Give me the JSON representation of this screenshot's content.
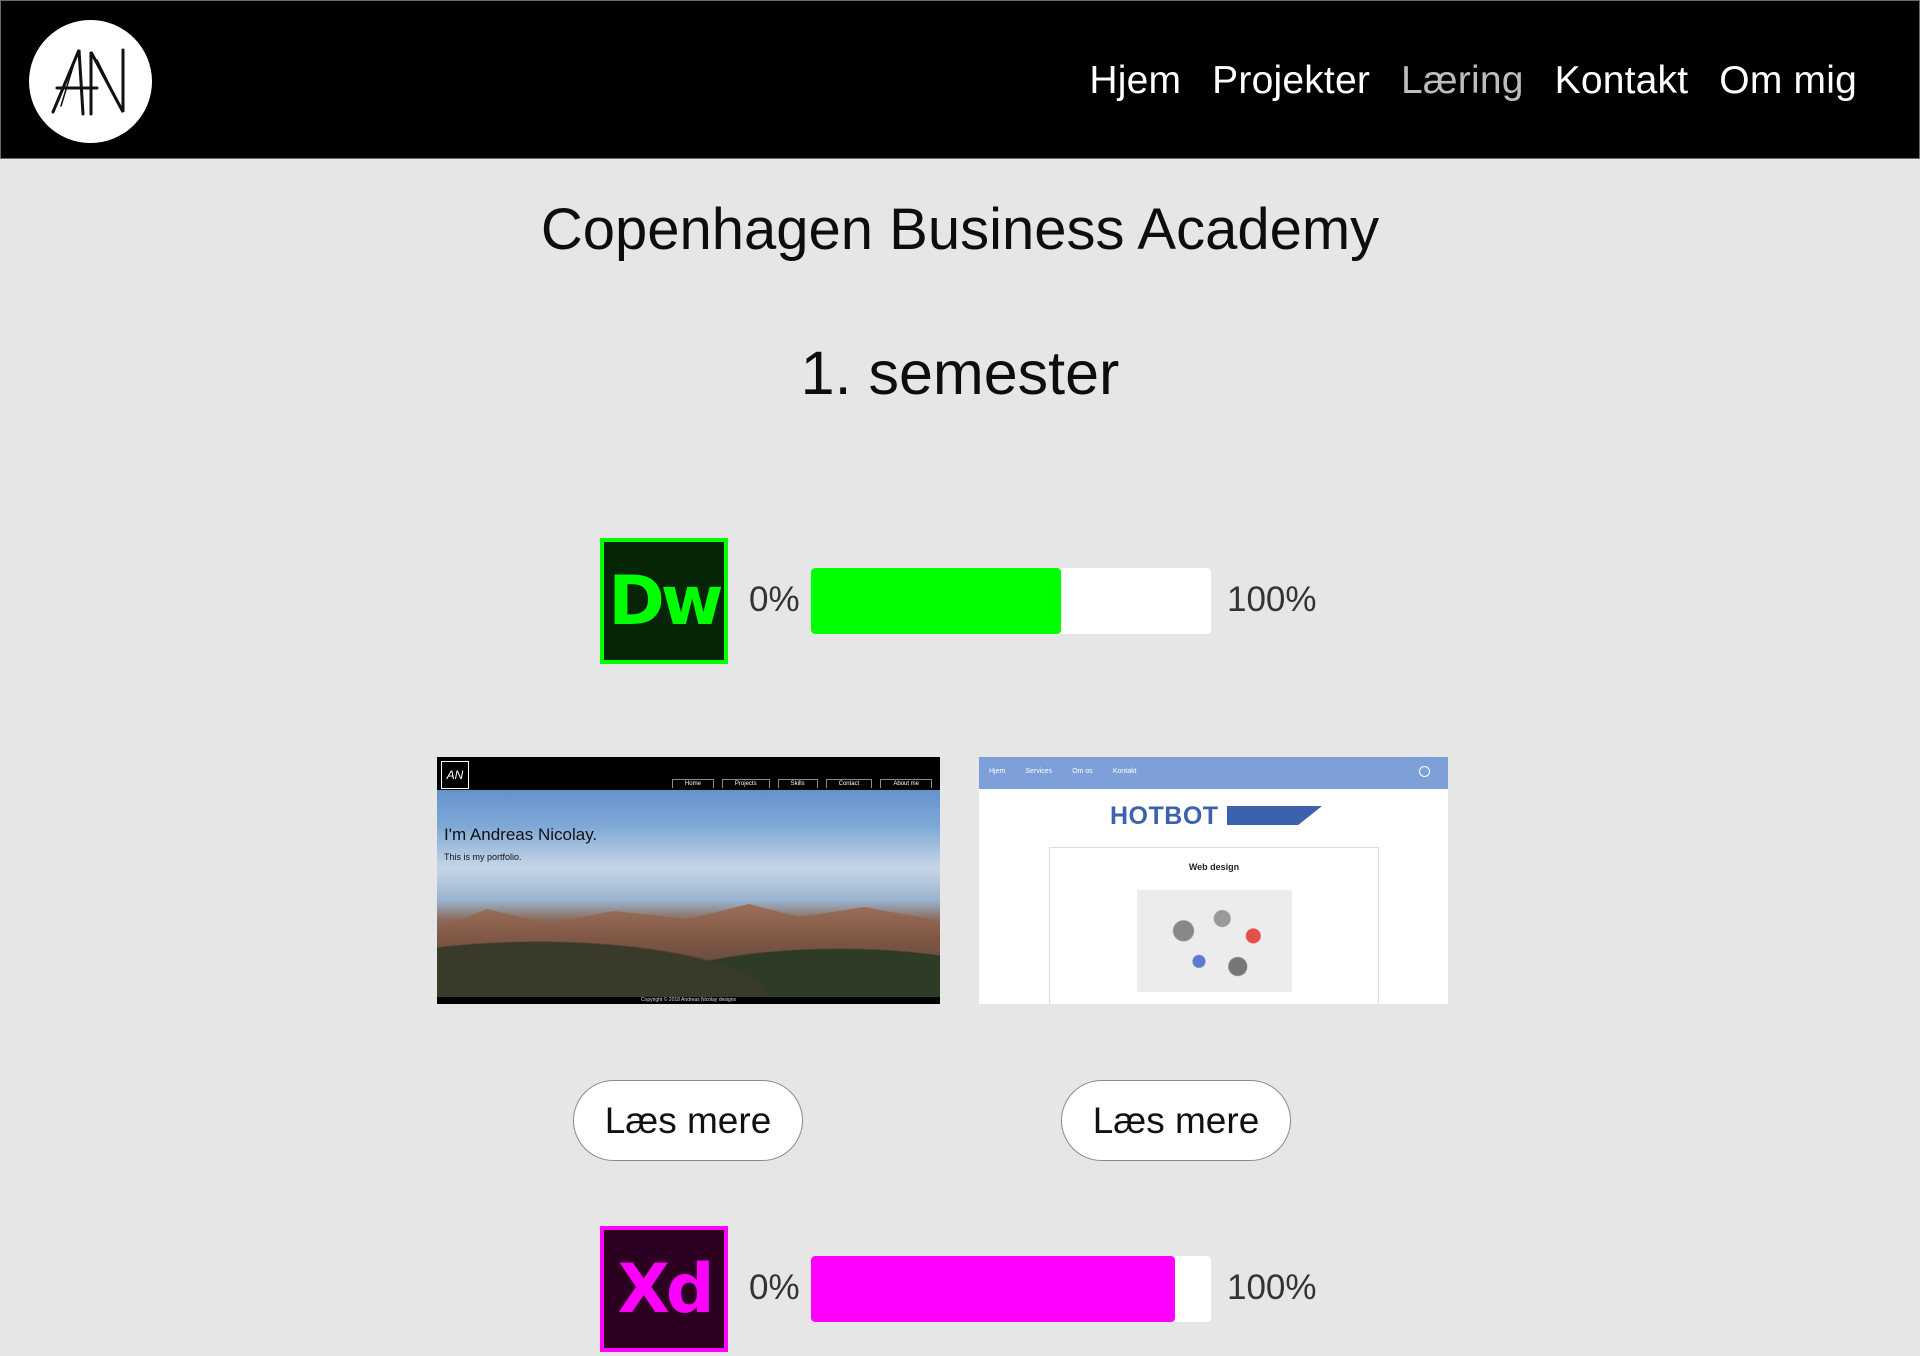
{
  "header": {
    "logo_text": "AN",
    "nav": [
      {
        "label": "Hjem",
        "active": false
      },
      {
        "label": "Projekter",
        "active": false
      },
      {
        "label": "Læring",
        "active": true
      },
      {
        "label": "Kontakt",
        "active": false
      },
      {
        "label": "Om mig",
        "active": false
      }
    ]
  },
  "main": {
    "school": "Copenhagen Business Academy",
    "semester": "1. semester",
    "skills": [
      {
        "icon": "dreamweaver-icon",
        "icon_text": "Dw",
        "min_label": "0%",
        "max_label": "100%",
        "level": 0.625,
        "color": "#00ff00",
        "bg": "#062406"
      },
      {
        "icon": "xd-icon",
        "icon_text": "Xd",
        "min_label": "0%",
        "max_label": "100%",
        "level": 0.91,
        "color": "#ff00ff",
        "bg": "#2b0020"
      }
    ],
    "projects": [
      {
        "name": "portfolio",
        "hero_title": "I'm Andreas Nicolay.",
        "hero_sub": "This is my portfolio.",
        "mini_nav": [
          "Home",
          "Projects",
          "Skills",
          "Contact",
          "About me"
        ],
        "footer": "Copyright © 2018 Andreas Nicolay designs",
        "button": "Læs mere"
      },
      {
        "name": "hotbot",
        "nav": [
          "Hjem",
          "Services",
          "Om os",
          "Kontakt"
        ],
        "logo": "HOTBOT",
        "card_title": "Web design",
        "button": "Læs mere"
      }
    ]
  }
}
